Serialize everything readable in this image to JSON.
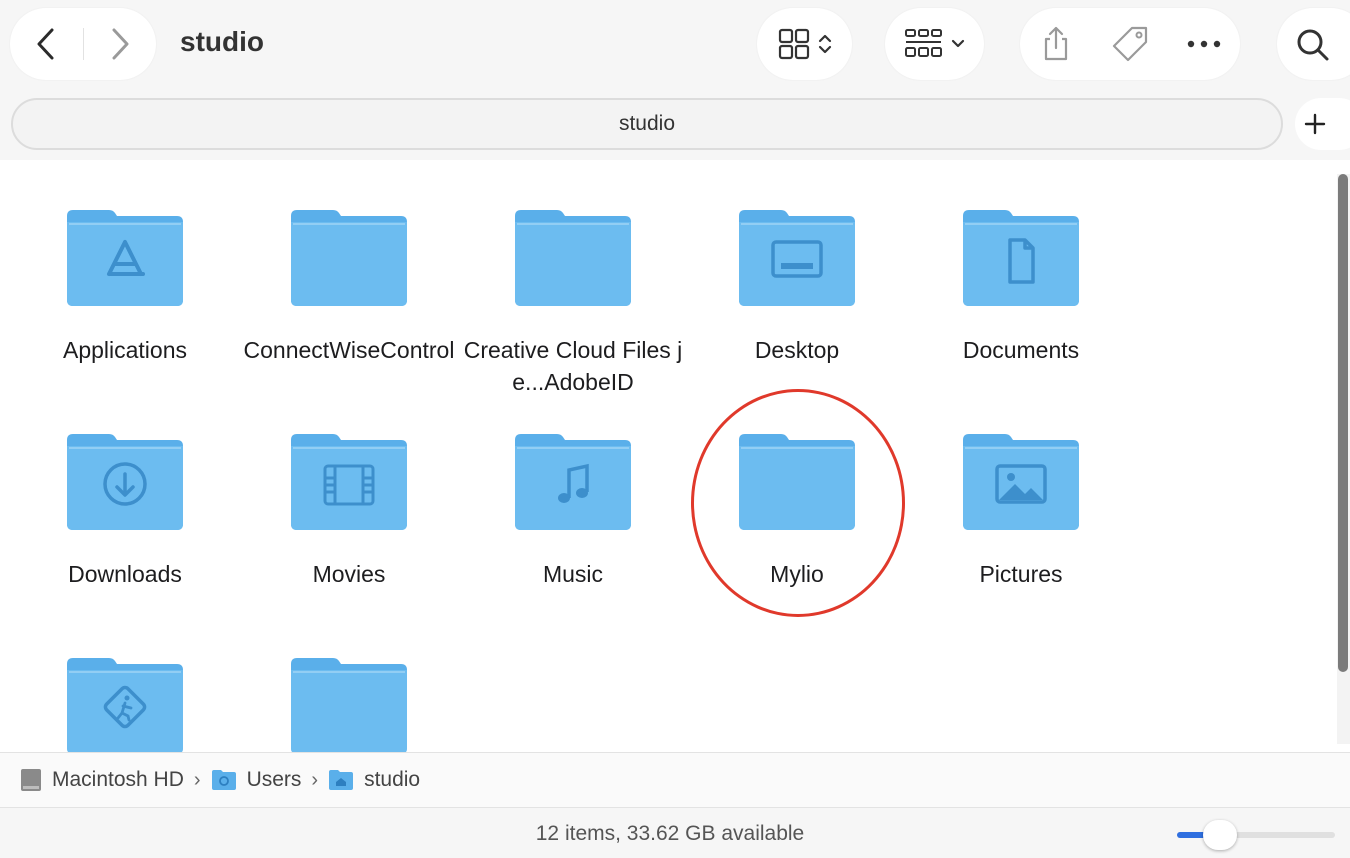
{
  "window": {
    "title": "studio"
  },
  "tab": {
    "label": "studio"
  },
  "toolbar": {
    "back_icon": "chevron-left-icon",
    "forward_icon": "chevron-right-icon",
    "view_icon": "icon-grid-icon",
    "group_icon": "group-grid-icon",
    "share_icon": "share-icon",
    "tag_icon": "tag-icon",
    "more_icon": "ellipsis-icon",
    "search_icon": "search-icon",
    "add_tab_icon": "plus-icon"
  },
  "files": [
    {
      "name": "Applications",
      "glyph": "applications"
    },
    {
      "name": "ConnectWiseControl",
      "glyph": "none"
    },
    {
      "name": "Creative Cloud Files  je...AdobeID",
      "glyph": "none"
    },
    {
      "name": "Desktop",
      "glyph": "desktop"
    },
    {
      "name": "Documents",
      "glyph": "document"
    },
    {
      "name": "Downloads",
      "glyph": "download"
    },
    {
      "name": "Movies",
      "glyph": "film"
    },
    {
      "name": "Music",
      "glyph": "music"
    },
    {
      "name": "Mylio",
      "glyph": "none",
      "highlighted": true
    },
    {
      "name": "Pictures",
      "glyph": "picture"
    },
    {
      "name": "",
      "glyph": "public"
    },
    {
      "name": "",
      "glyph": "none"
    }
  ],
  "path": [
    {
      "label": "Macintosh HD",
      "icon": "hard-drive-icon"
    },
    {
      "label": "Users",
      "icon": "users-folder-icon"
    },
    {
      "label": "studio",
      "icon": "home-folder-icon"
    }
  ],
  "status": {
    "text": "12 items, 33.62 GB available"
  },
  "zoom": {
    "value": 0.27
  },
  "colors": {
    "folder": "#5aafea",
    "accent": "#2f6fe0",
    "highlight": "#e0392b"
  }
}
